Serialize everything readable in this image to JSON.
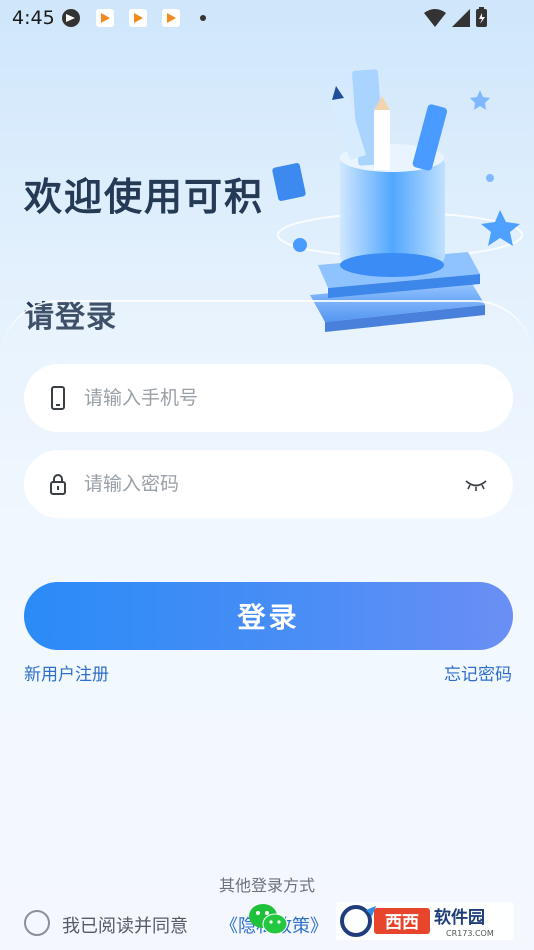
{
  "status_bar": {
    "time": "4:45"
  },
  "header": {
    "welcome": "欢迎使用可积",
    "subtitle": "请登录"
  },
  "form": {
    "phone_placeholder": "请输入手机号",
    "password_placeholder": "请输入密码",
    "login_label": "登录",
    "register_label": "新用户注册",
    "forgot_label": "忘记密码"
  },
  "footer": {
    "other_login": "其他登录方式",
    "agree_text": "我已阅读并同意",
    "policy_link": "《隐私政策》"
  },
  "watermark": {
    "brand": "西西软件园",
    "domain": "CR173.COM"
  },
  "colors": {
    "accent": "#2a8bf7",
    "link": "#2e6fcb",
    "heading": "#243a55"
  }
}
